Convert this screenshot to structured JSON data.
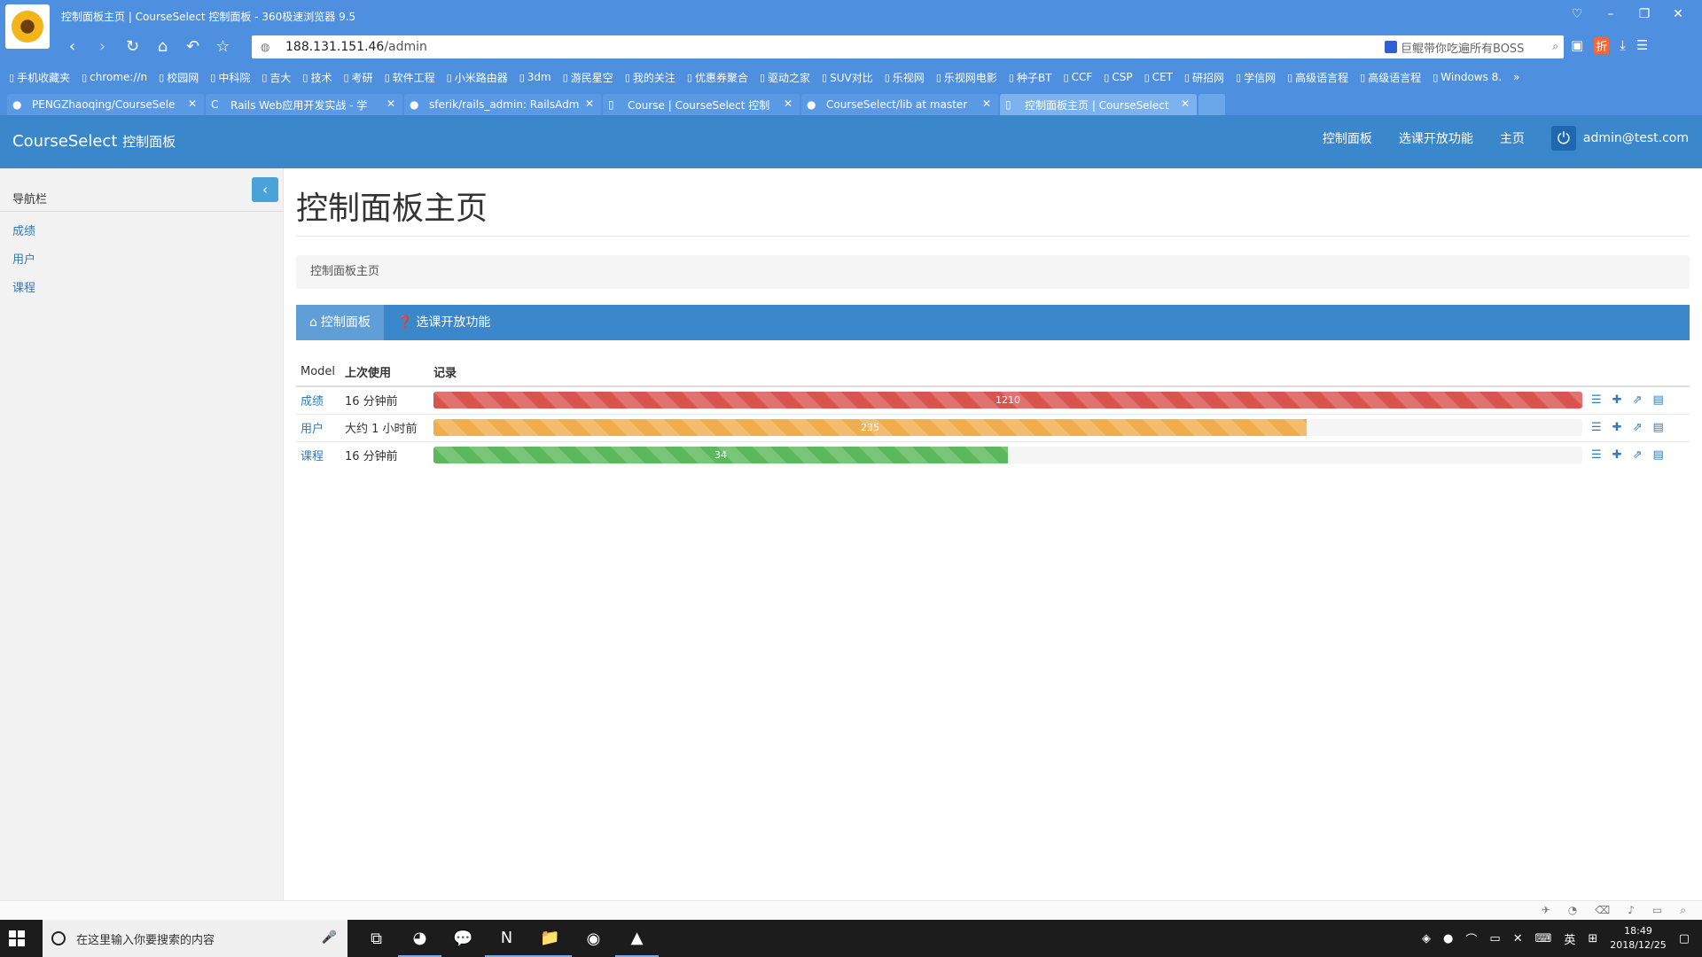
{
  "browser": {
    "title": "控制面板主页 | CourseSelect 控制面板 - 360极速浏览器 9.5",
    "url_host": "188.131.151.46",
    "url_path": "/admin",
    "search_placeholder": "巨鲲带你吃遍所有BOSS",
    "zhe_label": "折",
    "bookmarks": [
      "手机收藏夹",
      "chrome://n",
      "校园网",
      "中科院",
      "吉大",
      "技术",
      "考研",
      "软件工程",
      "小米路由器",
      "3dm",
      "游民星空",
      "我的关注",
      "优惠券聚合",
      "驱动之家",
      "SUV对比",
      "乐视网",
      "乐视网电影",
      "种子BT",
      "CCF",
      "CSP",
      "CET",
      "研招网",
      "学信网",
      "高级语言程",
      "高级语言程",
      "Windows 8."
    ],
    "tabs": [
      {
        "label": "PENGZhaoqing/CourseSele",
        "icon": "github-icon"
      },
      {
        "label": "Rails Web应用开发实战 - 学",
        "icon": "c-icon"
      },
      {
        "label": "sferik/rails_admin: RailsAdm",
        "icon": "github-icon"
      },
      {
        "label": "Course | CourseSelect 控制",
        "icon": "page-icon"
      },
      {
        "label": "CourseSelect/lib at master",
        "icon": "github-icon"
      },
      {
        "label": "控制面板主页 | CourseSelect",
        "icon": "page-icon"
      }
    ]
  },
  "app": {
    "brand": "CourseSelect",
    "brand_small": "控制面板",
    "nav": [
      "控制面板",
      "选课开放功能",
      "主页"
    ],
    "user": "admin@test.com"
  },
  "sidebar": {
    "heading": "导航栏",
    "items": [
      "成绩",
      "用户",
      "课程"
    ]
  },
  "main": {
    "page_title": "控制面板主页",
    "breadcrumb": "控制面板主页",
    "actions": [
      {
        "label": "控制面板",
        "icon": "home-icon",
        "active": true
      },
      {
        "label": "选课开放功能",
        "icon": "question-circle-icon",
        "active": false
      }
    ],
    "table": {
      "headers": [
        "Model",
        "上次使用",
        "记录"
      ],
      "rows": [
        {
          "model": "成绩",
          "last_used": "16 分钟前",
          "records": "1210",
          "fill": 1.0,
          "color": "#d9534f"
        },
        {
          "model": "用户",
          "last_used": "大约 1 小时前",
          "records": "235",
          "fill": 0.76,
          "color": "#f0ad4e"
        },
        {
          "model": "课程",
          "last_used": "16 分钟前",
          "records": "34",
          "fill": 0.5,
          "color": "#5cb85c"
        }
      ]
    }
  },
  "taskbar": {
    "search_placeholder": "在这里输入你要搜索的内容",
    "ime": "英",
    "time": "18:49",
    "date": "2018/12/25"
  }
}
